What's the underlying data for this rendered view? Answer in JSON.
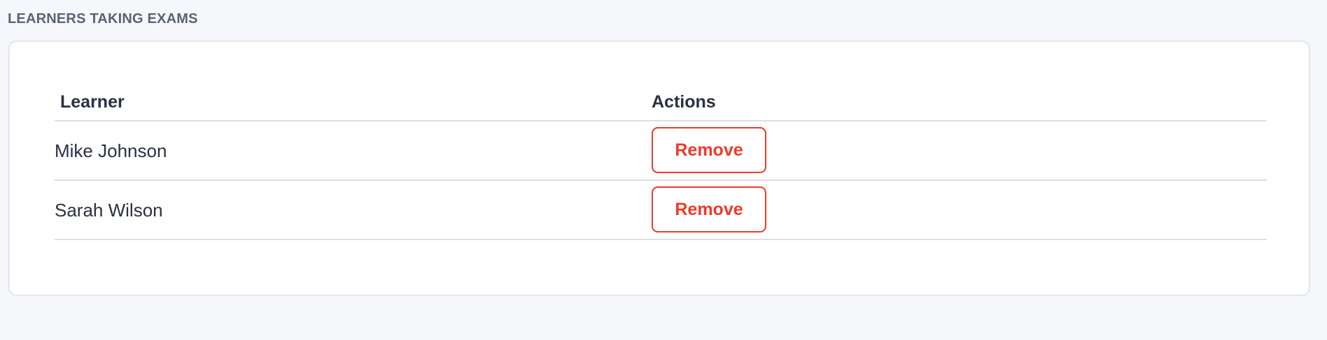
{
  "section": {
    "title": "LEARNERS TAKING EXAMS"
  },
  "table": {
    "columns": [
      "Learner",
      "Actions"
    ],
    "rows": [
      {
        "name": "Mike Johnson",
        "action_label": "Remove"
      },
      {
        "name": "Sarah Wilson",
        "action_label": "Remove"
      }
    ]
  },
  "colors": {
    "danger": "#ee3a2b",
    "background": "#f6f7fb",
    "card": "#ffffff"
  }
}
